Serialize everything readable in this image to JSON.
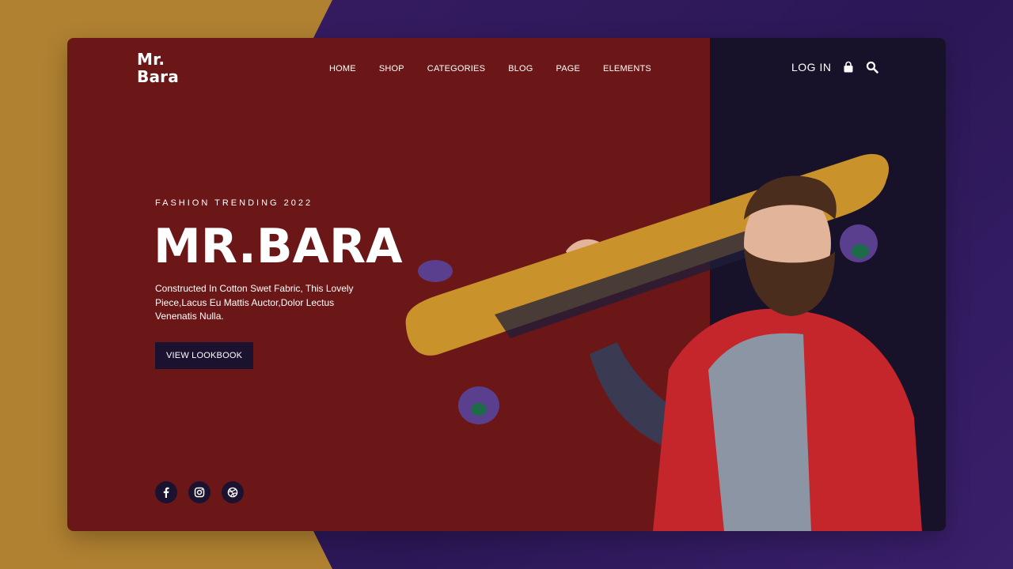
{
  "brand": {
    "line1": "Mr.",
    "line2": "Bara"
  },
  "nav": {
    "items": [
      {
        "label": "HOME"
      },
      {
        "label": "SHOP"
      },
      {
        "label": "CATEGORIES"
      },
      {
        "label": "BLOG"
      },
      {
        "label": "PAGE"
      },
      {
        "label": "ELEMENTS"
      }
    ]
  },
  "header": {
    "login_label": "LOG IN",
    "icons": [
      "shopping-bag-icon",
      "search-icon"
    ]
  },
  "hero": {
    "eyebrow": "FASHION TRENDING 2022",
    "title": "MR.BARA",
    "description": "Constructed In Cotton Swet Fabric, This Lovely Piece,Lacus Eu Mattis Auctor,Dolor Lectus Venenatis Nulla.",
    "cta_label": "VIEW LOOKBOOK"
  },
  "social": {
    "icons": [
      "facebook-icon",
      "instagram-icon",
      "dribbble-icon"
    ]
  },
  "colors": {
    "card_red": "#6b1718",
    "panel_dark": "#18112a",
    "gold": "#b08131",
    "purple": "#2f1a5c",
    "button_dark": "#1b1230"
  }
}
